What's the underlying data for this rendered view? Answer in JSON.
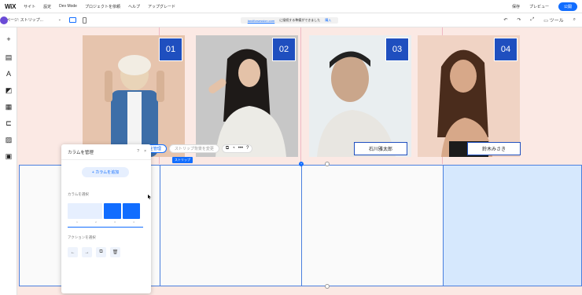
{
  "topbar": {
    "logo": "WiX",
    "menu": [
      "サイト",
      "設定",
      "Dev Mode",
      "プロジェクトを依頼",
      "ヘルプ",
      "アップグレード"
    ],
    "save": "保存",
    "preview": "プレビュー",
    "publish": "公開"
  },
  "secondbar": {
    "page": "ページ: ストリップ...",
    "url_domain": "landforsession.com",
    "url_note": "に接続する準備ができました",
    "connect": "購入",
    "tools": "ツール"
  },
  "cards": [
    {
      "number": "01",
      "name": ""
    },
    {
      "number": "02",
      "name": ""
    },
    {
      "number": "03",
      "name": "石川雅太郎"
    },
    {
      "number": "04",
      "name": "鈴木みさき"
    }
  ],
  "floating_toolbar": {
    "manage_columns": "カラムを管理",
    "change_bg": "ストリップ背景を変更"
  },
  "strip": {
    "label": "ストリップ"
  },
  "panel": {
    "title": "カラムを管理",
    "help": "?",
    "close": "×",
    "add_column": "+ カラムを追加",
    "select_column_label": "カラムを選択",
    "select_action_label": "アクションを選択",
    "slider_ticks": [
      "1",
      "2",
      "3",
      "4"
    ]
  },
  "colors": {
    "accent": "#116dff",
    "canvas_bg": "#fbe9e4",
    "number_box": "#1f4fbf",
    "selected_col": "#d6e8fd"
  }
}
